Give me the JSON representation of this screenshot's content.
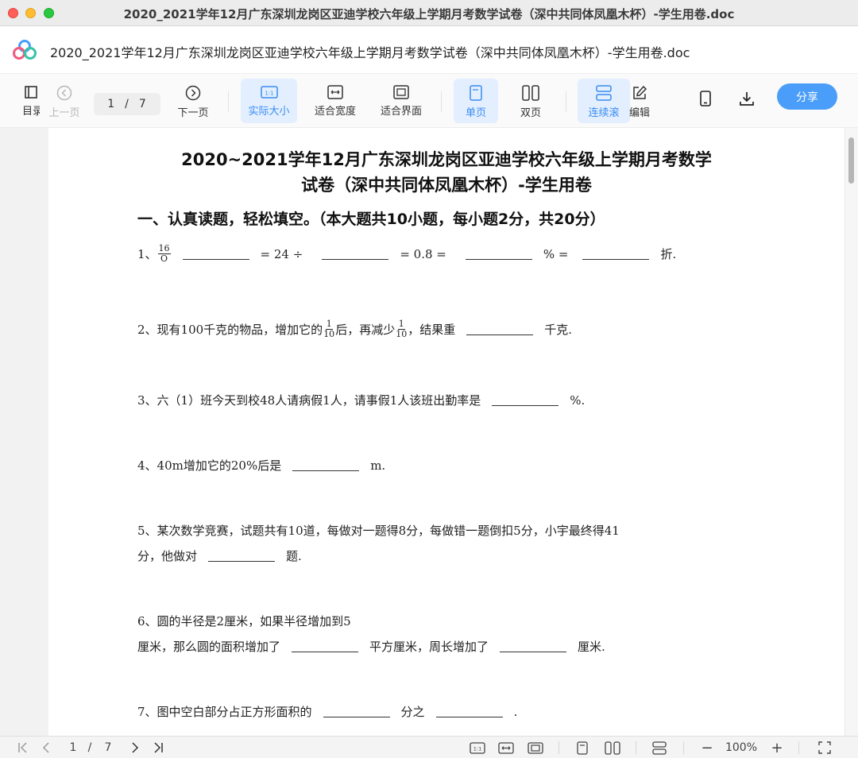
{
  "window": {
    "title": "2020_2021学年12月广东深圳龙岗区亚迪学校六年级上学期月考数学试卷（深中共同体凤凰木杯）-学生用卷.doc"
  },
  "header": {
    "doc_name": "2020_2021学年12月广东深圳龙岗区亚迪学校六年级上学期月考数学试卷（深中共同体凤凰木杯）-学生用卷.doc"
  },
  "toolbar": {
    "toc_label": "目录",
    "prev_label": "上一页",
    "page_current": "1",
    "page_sep": "/",
    "page_total": "7",
    "next_label": "下一页",
    "actual_size_label": "实际大小",
    "fit_width_label": "适合宽度",
    "fit_page_label": "适合界面",
    "single_label": "单页",
    "double_label": "双页",
    "continuous_label": "连续滚",
    "edit_label": "编辑",
    "share_label": "分享",
    "accent": "#3b8cf0"
  },
  "document": {
    "title_line1": "2020~2021学年12月广东深圳龙岗区亚迪学校六年级上学期月考数学",
    "title_line2": "试卷（深中共同体凤凰木杯）-学生用卷",
    "section1": "一、认真读题，轻松填空。（本大题共10小题，每小题2分，共20分）",
    "q1": {
      "prefix": "1、",
      "frac_num": "16",
      "frac_den": "O",
      "eq1": "= 24 ÷",
      "eq2": "= 0.8 =",
      "pct": "% =",
      "suffix": "折."
    },
    "q2": {
      "prefix": "2、现有100千克的物品，增加它的",
      "frac_num": "1",
      "frac_den": "10",
      "mid": "后，再减少",
      "frac2_num": "1",
      "frac2_den": "10",
      "mid2": "，结果重",
      "suffix": "千克."
    },
    "q3": {
      "text": "3、六（1）班今天到校48人请病假1人，请事假1人该班出勤率是",
      "suffix": "%."
    },
    "q4": {
      "text": "4、40m增加它的20%后是",
      "suffix": "m."
    },
    "q5": {
      "line1": "5、某次数学竞赛，试题共有10道，每做对一题得8分，每做错一题倒扣5分，小宇最终得41",
      "line2": "分，他做对",
      "suffix": "题."
    },
    "q6": {
      "line1": "6、圆的半径是2厘米，如果半径增加到5",
      "line2": "厘米，那么圆的面积增加了",
      "mid": "平方厘米，周长增加了",
      "suffix": "厘米."
    },
    "q7": {
      "text": "7、图中空白部分占正方形面积的",
      "mid": "分之",
      "suffix": "."
    }
  },
  "bottombar": {
    "page_current": "1",
    "page_sep": "/",
    "page_total": "7",
    "zoom_minus": "−",
    "zoom": "100%",
    "zoom_plus": "+"
  }
}
